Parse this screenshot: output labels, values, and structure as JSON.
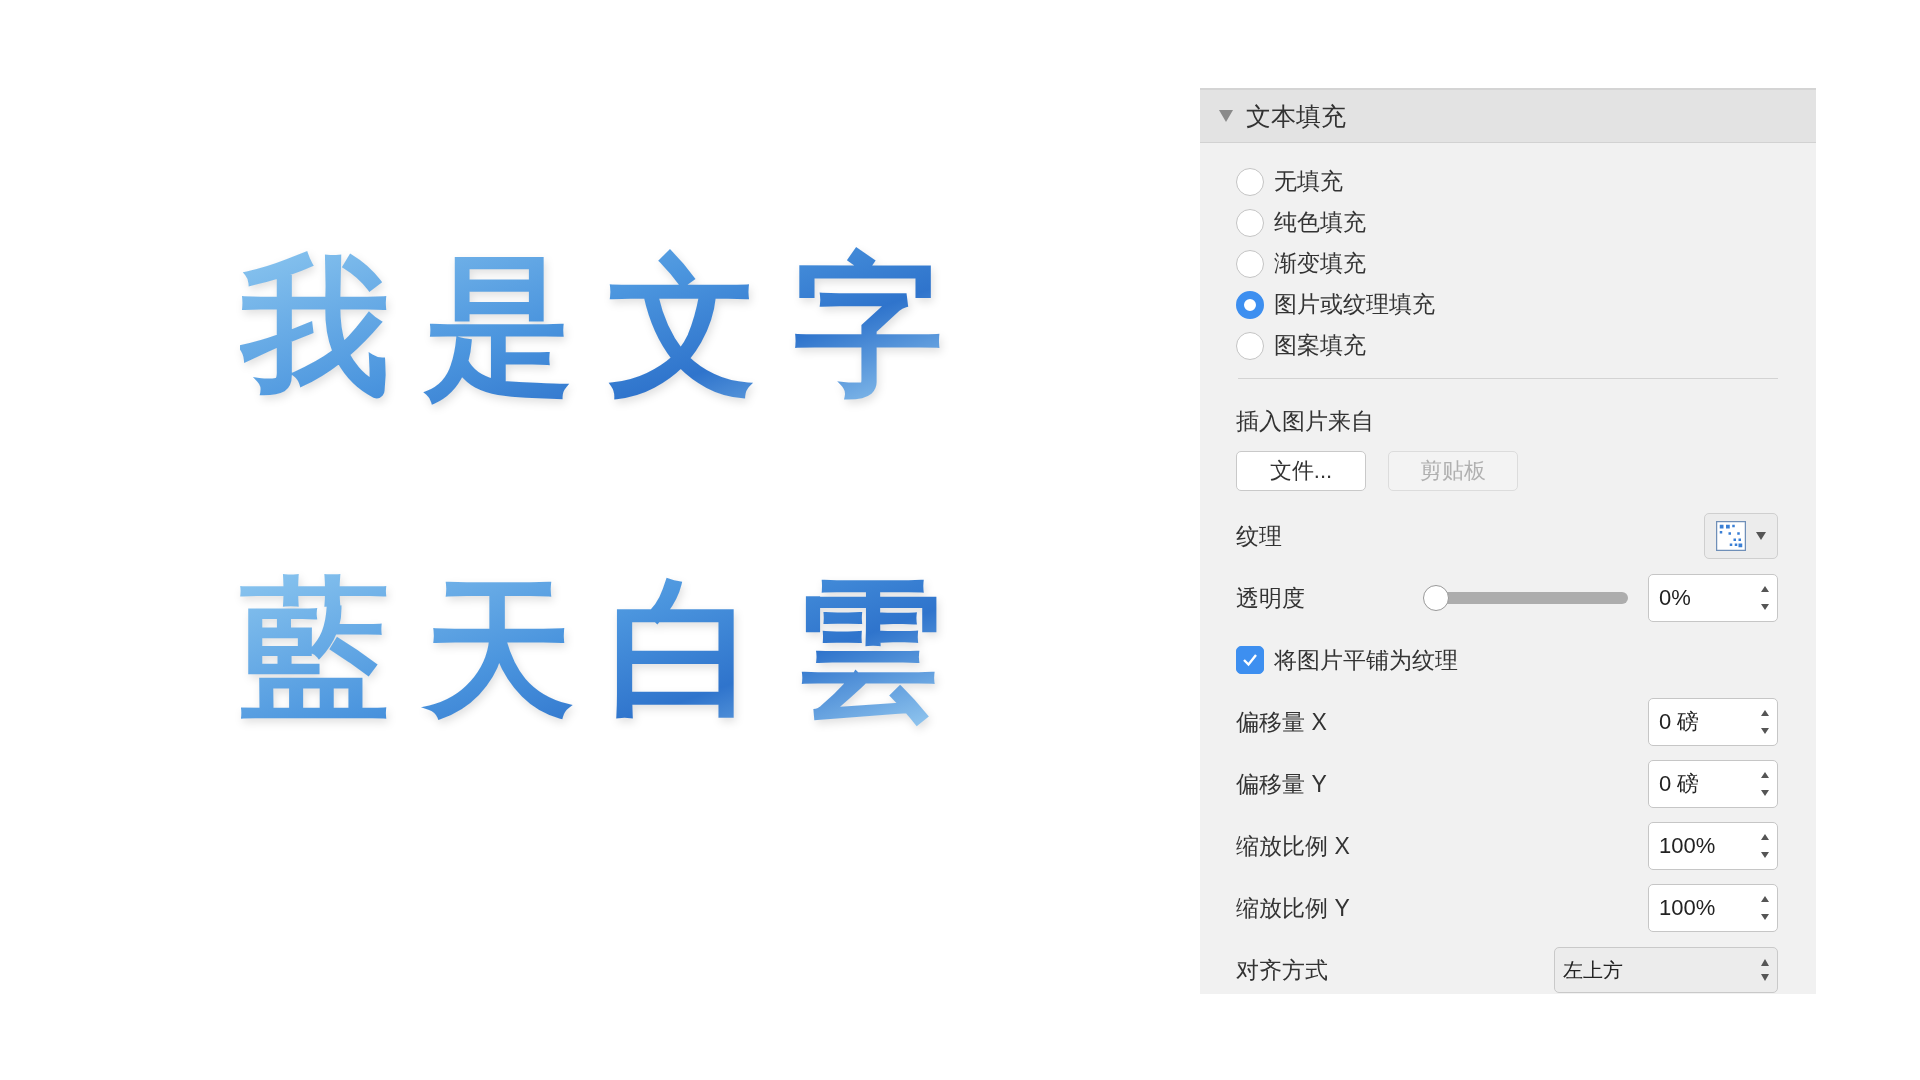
{
  "slide": {
    "lines": [
      "我 是 文 字",
      "藍 天 白 雲"
    ]
  },
  "panel": {
    "title": "文本填充",
    "expanded": true,
    "fill_options": [
      {
        "label": "无填充",
        "selected": false
      },
      {
        "label": "纯色填充",
        "selected": false
      },
      {
        "label": "渐变填充",
        "selected": false
      },
      {
        "label": "图片或纹理填充",
        "selected": true
      },
      {
        "label": "图案填充",
        "selected": false
      }
    ],
    "insert_from_label": "插入图片来自",
    "buttons": [
      {
        "label": "文件...",
        "disabled": false
      },
      {
        "label": "剪贴板",
        "disabled": true
      }
    ],
    "texture": {
      "label": "纹理"
    },
    "transparency": {
      "label": "透明度",
      "level": 0,
      "value": "0%"
    },
    "tile": {
      "label": "将图片平铺为纹理",
      "checked": true
    },
    "spin_fields": [
      {
        "label": "偏移量 X",
        "value": "0 磅"
      },
      {
        "label": "偏移量 Y",
        "value": "0 磅"
      },
      {
        "label": "缩放比例 X",
        "value": "100%"
      },
      {
        "label": "缩放比例 Y",
        "value": "100%"
      }
    ],
    "alignment": {
      "label": "对齐方式",
      "value": "左上方"
    }
  }
}
